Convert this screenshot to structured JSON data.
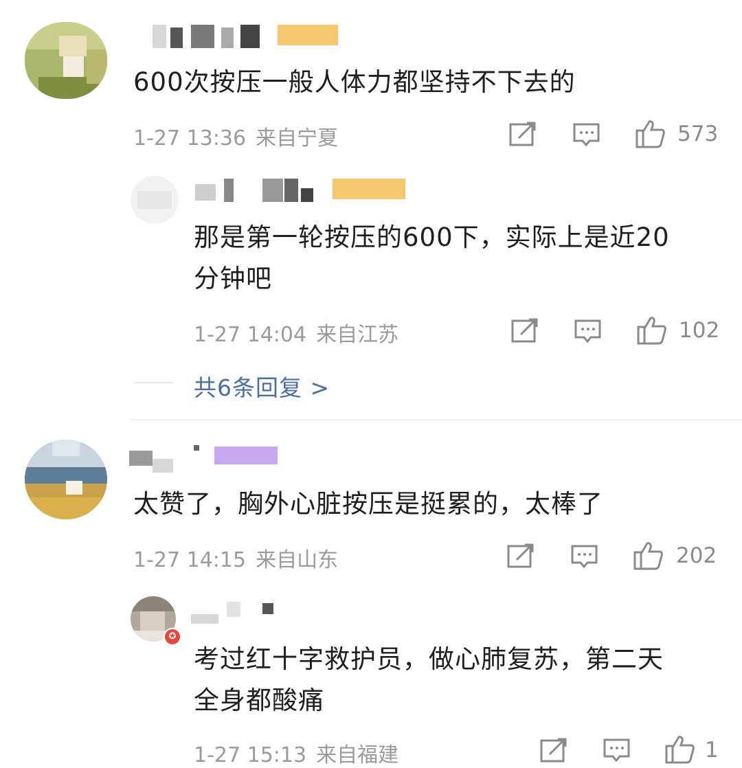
{
  "comments": [
    {
      "text": "600次按压一般人体力都坚持不下去的",
      "date": "1-27 13:36",
      "location": "来自宁夏",
      "likes": "573",
      "avatar_icon": "user-avatar-photo",
      "replies": [
        {
          "text_line1": "那是第一轮按压的600下，实际上是近20",
          "text_line2": "分钟吧",
          "date": "1-27 14:04",
          "location": "来自江苏",
          "likes": "102"
        }
      ],
      "more_replies": "共6条回复 >"
    },
    {
      "text": "太赞了，胸外心脏按压是挺累的，太棒了",
      "date": "1-27 14:15",
      "location": "来自山东",
      "likes": "202",
      "replies": [
        {
          "text_line1": "考过红十字救护员，做心肺复苏，第二天",
          "text_line2": "全身都酸痛",
          "date": "1-27 15:13",
          "location": "来自福建",
          "likes": "1"
        }
      ]
    }
  ],
  "icons": {
    "share": "share-icon",
    "comment": "comment-icon",
    "like": "thumbs-up-icon"
  },
  "colors": {
    "link": "#4a6da6",
    "meta": "#9a9a9a",
    "text": "#1e1e1e"
  }
}
